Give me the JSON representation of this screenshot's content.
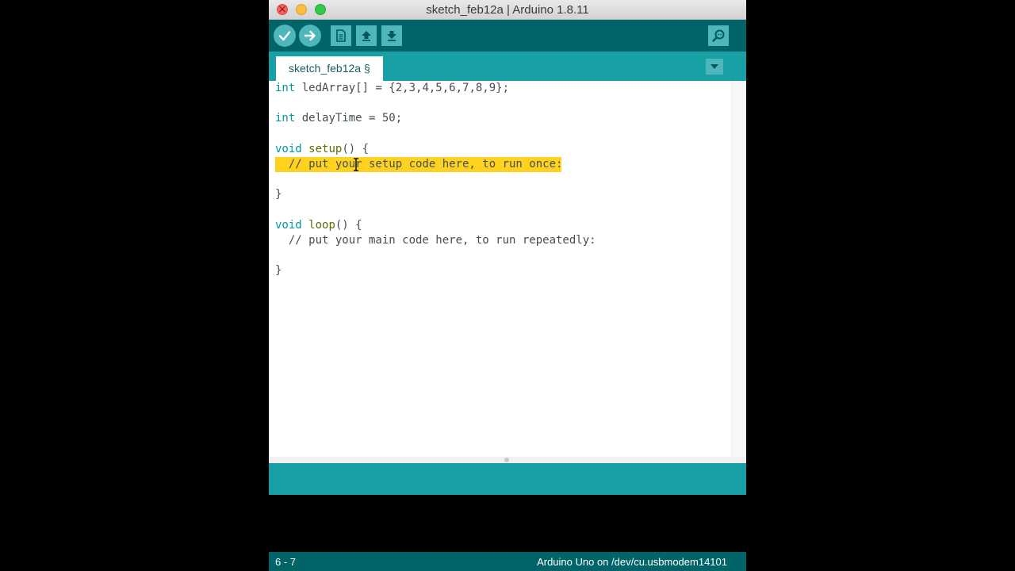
{
  "window": {
    "title": "sketch_feb12a | Arduino 1.8.11"
  },
  "toolbar": {
    "buttons": [
      "verify-icon",
      "upload-icon",
      "new-icon",
      "open-icon",
      "save-icon",
      "serial-monitor-icon"
    ]
  },
  "tabs": [
    {
      "label": "sketch_feb12a §",
      "active": true
    }
  ],
  "editor": {
    "lines": [
      {
        "type": "int",
        "rest": " ledArray[] = {2,3,4,5,6,7,8,9};"
      },
      {
        "type": "int",
        "rest": " delayTime = 50;"
      },
      {
        "kw": "void",
        "fn": "setup",
        "rest": "() {"
      },
      {
        "comment": "  // put your setup code here, to run once:",
        "selected": true
      },
      {
        "text": "}"
      },
      {
        "kw": "void",
        "fn": "loop",
        "rest": "() {"
      },
      {
        "comment": "  // put your main code here, to run repeatedly:"
      },
      {
        "text": "}"
      }
    ]
  },
  "status": {
    "line_range": "6 - 7",
    "board": "Arduino Uno on /dev/cu.usbmodem14101"
  },
  "colors": {
    "toolbar": "#006468",
    "tabbar": "#17a1a5",
    "button": "#4db7bb",
    "selection": "#ffd21f",
    "keyword_type": "#00979c",
    "keyword_function": "#5e6d03"
  }
}
